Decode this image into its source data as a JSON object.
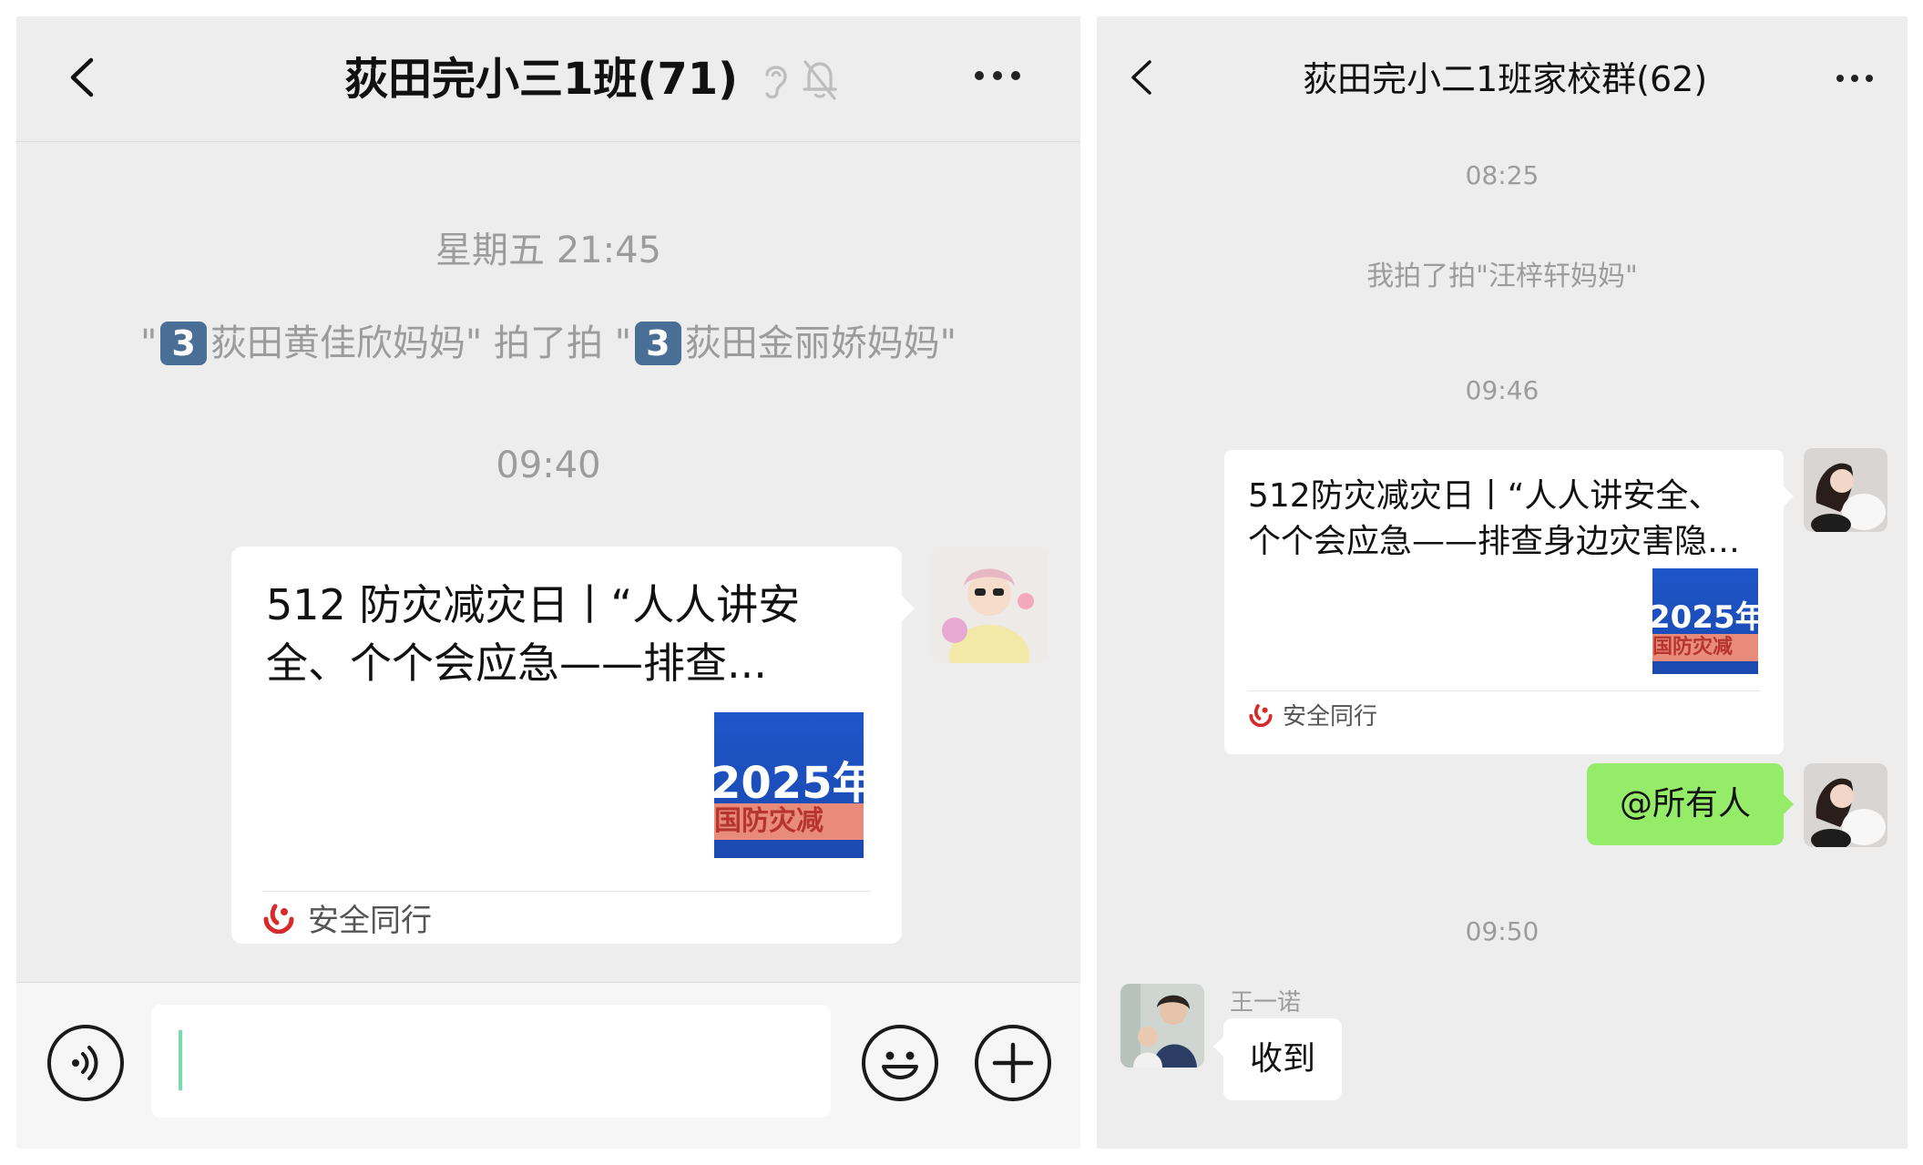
{
  "left": {
    "title": "荻田完小三1班(71)",
    "timestamp_1": "星期五 21:45",
    "pat": {
      "quote_open": "\"",
      "badge_1": "3",
      "actor": "荻田黄佳欣妈妈\"",
      "verb": "拍了拍 \"",
      "badge_2": "3",
      "target": "荻田金丽娇妈妈\""
    },
    "timestamp_2": "09:40",
    "card": {
      "title_line1": "512 防灾减灾日丨“人人讲安",
      "title_line2": "全、个个会应急——排查...",
      "thumb_text_1": "2025年",
      "thumb_text_2": "国防灾减",
      "source": "安全同行"
    },
    "icons": [
      "back-icon",
      "ear-icon",
      "mute-bell-icon",
      "more-icon",
      "voice-icon",
      "emoji-icon",
      "plus-icon"
    ]
  },
  "right": {
    "title": "荻田完小二1班家校群(62)",
    "timestamp_1": "08:25",
    "pat_text": "我拍了拍\"汪梓轩妈妈\"",
    "timestamp_2": "09:46",
    "card": {
      "title_line1": "512防灾减灾日丨“人人讲安全、",
      "title_line2": "个个会应急——排查身边灾害隐…",
      "thumb_text_1": "2025年",
      "thumb_text_2": "国防灾减",
      "source": "安全同行"
    },
    "mention_message": "@所有人",
    "timestamp_3": "09:50",
    "reply": {
      "sender": "王一诺",
      "text": "收到"
    }
  },
  "colors": {
    "chat_bg": "#ededed",
    "sent_bubble": "#95ec69",
    "timestamp": "#9c9c9c",
    "badge": "#4a6f96"
  }
}
